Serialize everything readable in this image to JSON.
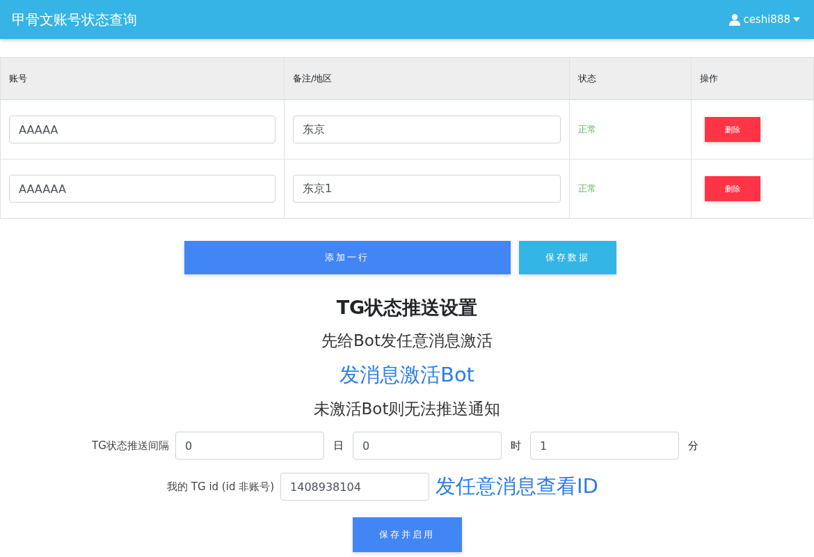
{
  "navbar": {
    "title": "甲骨文账号状态查询",
    "user": "ceshi888"
  },
  "table": {
    "columns": [
      "账号",
      "备注/地区",
      "状态",
      "操作"
    ],
    "rows": [
      {
        "account": "AAAAA",
        "note": "东京",
        "status": "正常",
        "action": "删除"
      },
      {
        "account": "AAAAAA",
        "note": "东京1",
        "status": "正常",
        "action": "删除"
      }
    ]
  },
  "buttons": {
    "add": "添加一行",
    "save": "保存数据"
  },
  "tg": {
    "title": "TG状态推送设置",
    "line1": "先给Bot发任意消息激活",
    "link1": "发消息激活Bot",
    "line2": "未激活Bot则无法推送通知",
    "interval_label": "TG状态推送间隔",
    "interval": [
      {
        "value": "0",
        "unit": "日"
      },
      {
        "value": "0",
        "unit": "时"
      },
      {
        "value": "1",
        "unit": "分"
      }
    ],
    "id_label": "我的 TG id (id 非账号)",
    "id_value": "1408938104",
    "id_link": "发任意消息查看ID",
    "submit": "保存并启用"
  }
}
